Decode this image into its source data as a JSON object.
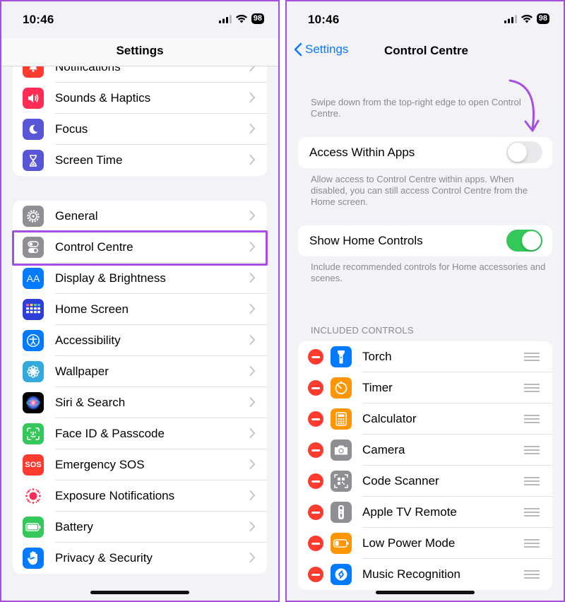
{
  "left": {
    "status_time": "10:46",
    "battery": "98",
    "title": "Settings",
    "group1": [
      {
        "label": "Notifications",
        "icon": "bell-icon",
        "color": "#ff3b30"
      },
      {
        "label": "Sounds & Haptics",
        "icon": "speaker-icon",
        "color": "#ff2d55"
      },
      {
        "label": "Focus",
        "icon": "moon-icon",
        "color": "#5856d6"
      },
      {
        "label": "Screen Time",
        "icon": "hourglass-icon",
        "color": "#5856d6"
      }
    ],
    "group2": [
      {
        "label": "General",
        "icon": "gear-icon",
        "color": "#8e8e93"
      },
      {
        "label": "Control Centre",
        "icon": "toggles-icon",
        "color": "#8e8e93"
      },
      {
        "label": "Display & Brightness",
        "icon": "text-size-icon",
        "color": "#007aff",
        "glyph": "AA"
      },
      {
        "label": "Home Screen",
        "icon": "app-grid-icon",
        "color": "#2c3fd6"
      },
      {
        "label": "Accessibility",
        "icon": "accessibility-icon",
        "color": "#007aff"
      },
      {
        "label": "Wallpaper",
        "icon": "flower-icon",
        "color": "#34aadc"
      },
      {
        "label": "Siri & Search",
        "icon": "siri-icon",
        "color": "#000000"
      },
      {
        "label": "Face ID & Passcode",
        "icon": "face-id-icon",
        "color": "#34c759"
      },
      {
        "label": "Emergency SOS",
        "icon": "sos-icon",
        "color": "#ff3b30",
        "glyph": "SOS"
      },
      {
        "label": "Exposure Notifications",
        "icon": "exposure-icon",
        "color": "#ffffff"
      },
      {
        "label": "Battery",
        "icon": "battery-icon",
        "color": "#34c759"
      },
      {
        "label": "Privacy & Security",
        "icon": "hand-icon",
        "color": "#007aff"
      }
    ]
  },
  "right": {
    "status_time": "10:46",
    "battery": "98",
    "back_label": "Settings",
    "title": "Control Centre",
    "intro_note": "Swipe down from the top-right edge to open Control Centre.",
    "access_label": "Access Within Apps",
    "access_on": false,
    "access_note": "Allow access to Control Centre within apps. When disabled, you can still access Control Centre from the Home screen.",
    "home_label": "Show Home Controls",
    "home_on": true,
    "home_note": "Include recommended controls for Home accessories and scenes.",
    "included_header": "INCLUDED CONTROLS",
    "controls": [
      {
        "label": "Torch",
        "icon": "torch-icon",
        "color": "#007aff"
      },
      {
        "label": "Timer",
        "icon": "timer-icon",
        "color": "#ff9500"
      },
      {
        "label": "Calculator",
        "icon": "calculator-icon",
        "color": "#ff9500"
      },
      {
        "label": "Camera",
        "icon": "camera-icon",
        "color": "#8e8e93"
      },
      {
        "label": "Code Scanner",
        "icon": "qr-code-icon",
        "color": "#8e8e93"
      },
      {
        "label": "Apple TV Remote",
        "icon": "remote-icon",
        "color": "#8e8e93"
      },
      {
        "label": "Low Power Mode",
        "icon": "low-battery-icon",
        "color": "#ff9500"
      },
      {
        "label": "Music Recognition",
        "icon": "shazam-icon",
        "color": "#007aff"
      }
    ]
  },
  "colors": {
    "accent": "#a64ee3",
    "ios_blue": "#0a7aff",
    "toggle_on": "#34c759"
  }
}
